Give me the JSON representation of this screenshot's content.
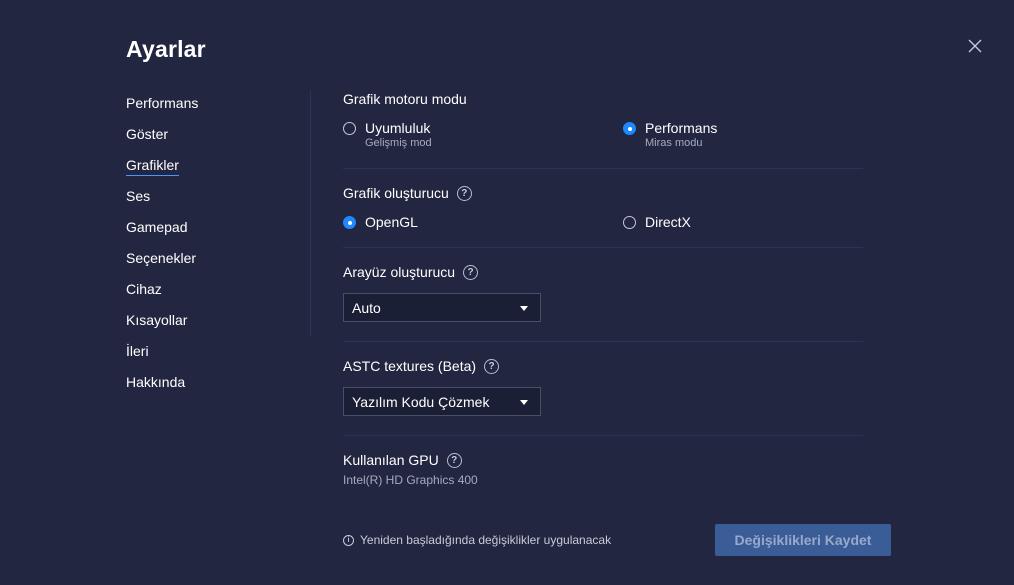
{
  "window": {
    "title": "Ayarlar"
  },
  "sidebar": {
    "items": [
      {
        "label": "Performans"
      },
      {
        "label": "Göster"
      },
      {
        "label": "Grafikler"
      },
      {
        "label": "Ses"
      },
      {
        "label": "Gamepad"
      },
      {
        "label": "Seçenekler"
      },
      {
        "label": "Cihaz"
      },
      {
        "label": "Kısayollar"
      },
      {
        "label": "İleri"
      },
      {
        "label": "Hakkında"
      }
    ],
    "active_index": 2
  },
  "graphics_engine": {
    "title": "Grafik motoru modu",
    "options": [
      {
        "label": "Uyumluluk",
        "sublabel": "Gelişmiş mod",
        "selected": false
      },
      {
        "label": "Performans",
        "sublabel": "Miras modu",
        "selected": true
      }
    ]
  },
  "renderer": {
    "title": "Grafik oluşturucu",
    "options": [
      {
        "label": "OpenGL",
        "selected": true
      },
      {
        "label": "DirectX",
        "selected": false
      }
    ]
  },
  "interface_renderer": {
    "title": "Arayüz oluşturucu",
    "value": "Auto"
  },
  "astc": {
    "title": "ASTC textures (Beta)",
    "value": "Yazılım Kodu Çözmek"
  },
  "gpu": {
    "title": "Kullanılan GPU",
    "value": "Intel(R) HD Graphics 400"
  },
  "footer": {
    "note": "Yeniden başladığında değişiklikler uygulanacak",
    "save_label": "Değişiklikleri Kaydet"
  },
  "icons": {
    "help": "?",
    "info": "i"
  },
  "colors": {
    "background": "#222640",
    "accent": "#1e88ff",
    "button": "#3a5c97"
  }
}
